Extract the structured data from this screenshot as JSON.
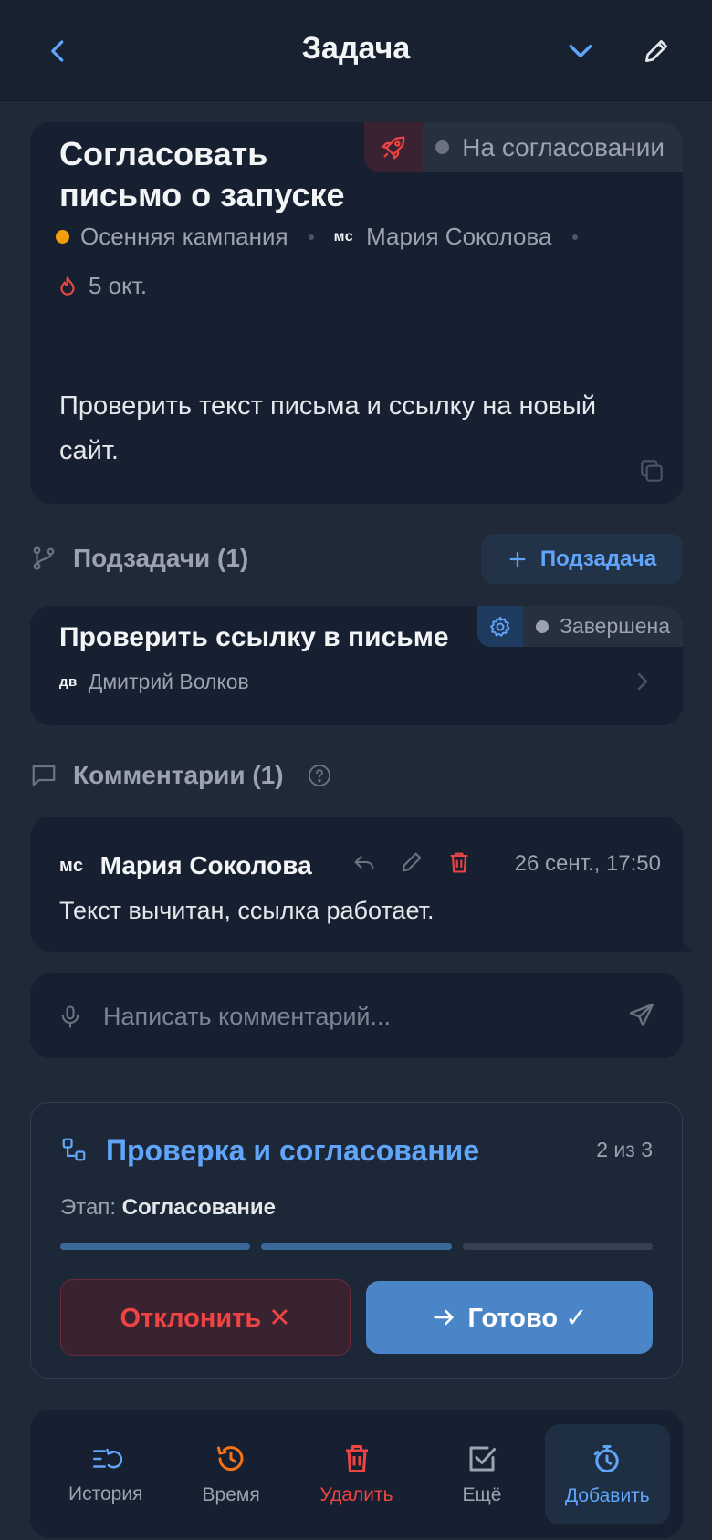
{
  "header": {
    "title": "Задача"
  },
  "task": {
    "title": "Согласовать письмо о запуске",
    "status": "На согласовании",
    "project": "Осенняя кампания",
    "assignee_initials": "мс",
    "assignee": "Мария Соколова",
    "due": "5 окт.",
    "description": "Проверить текст письма и ссылку на новый сайт."
  },
  "subtasks": {
    "heading": "Подзадачи (1)",
    "add_label": "Подзадача",
    "items": [
      {
        "title": "Проверить ссылку в письме",
        "status": "Завершена",
        "assignee_initials": "дв",
        "assignee": "Дмитрий Волков"
      }
    ]
  },
  "comments": {
    "heading": "Комментарии (1)",
    "items": [
      {
        "author_initials": "мс",
        "author": "Мария Соколова",
        "time": "26 сент., 17:50",
        "text": "Текст вычитан, ссылка работает."
      }
    ],
    "input_placeholder": "Написать комментарий..."
  },
  "workflow": {
    "title": "Проверка и согласование",
    "count": "2 из 3",
    "stage_label": "Этап:",
    "stage_value": "Согласование",
    "progress_completed": 2,
    "progress_total": 3,
    "reject_label": "Отклонить ✕",
    "done_label": "Готово ✓"
  },
  "bottom_bar": {
    "history": "История",
    "time": "Время",
    "delete": "Удалить",
    "more": "Ещё",
    "add": "Добавить"
  },
  "colors": {
    "accent": "#60a5fa",
    "danger": "#ef4444",
    "project_dot": "#f59e0b",
    "time_icon": "#f97316"
  }
}
